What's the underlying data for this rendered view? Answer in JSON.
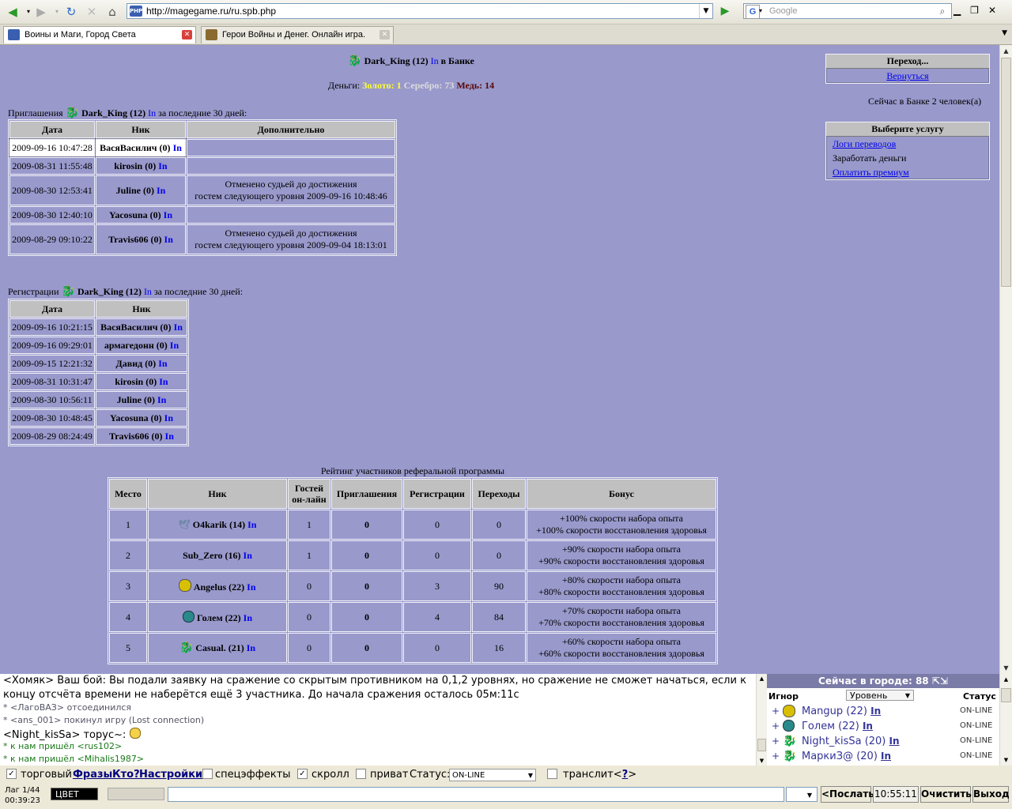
{
  "browser": {
    "url": "http://magegame.ru/ru.spb.php",
    "search_placeholder": "Google",
    "favicon_text": "PHP",
    "google_letter": "G",
    "tabs": [
      {
        "label": "Воины и Маги, Город Света",
        "active": true
      },
      {
        "label": "Герои Войны и Денег. Онлайн игра.",
        "active": false
      }
    ]
  },
  "bank": {
    "player": "Dark_King (12)",
    "info_link": "In",
    "location": "в Банке",
    "money_label": "Деньги:",
    "gold": "Золото: 1",
    "silver": "Серебро: 73",
    "copper": "Медь: 14",
    "people_in_bank": "Сейчас в Банке 2 человек(а)"
  },
  "nav_panel": {
    "title": "Переход...",
    "back": "Вернуться"
  },
  "services_panel": {
    "title": "Выберите услугу",
    "items": [
      {
        "label": "Логи переводов",
        "link": true
      },
      {
        "label": "Заработать деньги",
        "link": false
      },
      {
        "label": "Оплатить премиум",
        "link": true
      }
    ]
  },
  "invitations": {
    "prefix": "Приглашения",
    "player": "Dark_King (12)",
    "in": "In",
    "suffix": "за последние 30 дней:",
    "headers": [
      "Дата",
      "Ник",
      "Дополнительно"
    ],
    "rows": [
      {
        "date": "2009-09-16 10:47:28",
        "nick": "ВасяВасилич (0)",
        "extra1": "",
        "extra2": ""
      },
      {
        "date": "2009-08-31 11:55:48",
        "nick": "kirosin (0)",
        "extra1": "",
        "extra2": ""
      },
      {
        "date": "2009-08-30 12:53:41",
        "nick": "Juline (0)",
        "extra1": "Отменено судьей до достижения",
        "extra2": "гостем следующего уровня 2009-09-16 10:48:46"
      },
      {
        "date": "2009-08-30 12:40:10",
        "nick": "Yacosuna (0)",
        "extra1": "",
        "extra2": ""
      },
      {
        "date": "2009-08-29 09:10:22",
        "nick": "Travis606 (0)",
        "extra1": "Отменено судьей до достижения",
        "extra2": "гостем следующего уровня 2009-09-04 18:13:01"
      }
    ]
  },
  "registrations": {
    "prefix": "Регистрации",
    "player": "Dark_King (12)",
    "in": "In",
    "suffix": "за последние 30 дней:",
    "headers": [
      "Дата",
      "Ник"
    ],
    "rows": [
      {
        "date": "2009-09-16 10:21:15",
        "nick": "ВасяВасилич (0)"
      },
      {
        "date": "2009-09-16 09:29:01",
        "nick": "армагедонн (0)"
      },
      {
        "date": "2009-09-15 12:21:32",
        "nick": "Давид (0)"
      },
      {
        "date": "2009-08-31 10:31:47",
        "nick": "kirosin (0)"
      },
      {
        "date": "2009-08-30 10:56:11",
        "nick": "Juline (0)"
      },
      {
        "date": "2009-08-30 10:48:45",
        "nick": "Yacosuna (0)"
      },
      {
        "date": "2009-08-29 08:24:49",
        "nick": "Travis606 (0)"
      }
    ]
  },
  "rating": {
    "caption": "Рейтинг участников реферальной программы",
    "headers": [
      "Место",
      "Ник",
      "Гостей он-лайн",
      "Приглашения",
      "Регистрации",
      "Переходы",
      "Бонус"
    ],
    "rows": [
      {
        "place": "1",
        "icon": "guild-bird-icon",
        "nick": "O4karik (14)",
        "guests": "1",
        "invites": "0",
        "regs": "0",
        "clicks": "0",
        "bonus1": "+100% скорости набора опыта",
        "bonus2": "+100% скорости восстановления здоровья"
      },
      {
        "place": "2",
        "icon": "",
        "nick": "Sub_Zero (16)",
        "guests": "1",
        "invites": "0",
        "regs": "0",
        "clicks": "0",
        "bonus1": "+90% скорости набора опыта",
        "bonus2": "+90% скорости восстановления здоровья"
      },
      {
        "place": "3",
        "icon": "guild-yellow-icon",
        "nick": "Angelus (22)",
        "guests": "0",
        "invites": "0",
        "regs": "3",
        "clicks": "90",
        "bonus1": "+80% скорости набора опыта",
        "bonus2": "+80% скорости восстановления здоровья"
      },
      {
        "place": "4",
        "icon": "guild-teal-icon",
        "nick": "Голем (22)",
        "guests": "0",
        "invites": "0",
        "regs": "4",
        "clicks": "84",
        "bonus1": "+70% скорости набора опыта",
        "bonus2": "+70% скорости восстановления здоровья"
      },
      {
        "place": "5",
        "icon": "guild-dragon-icon",
        "nick": "Casual. (21)",
        "guests": "0",
        "invites": "0",
        "regs": "0",
        "clicks": "16",
        "bonus1": "+60% скорости набора опыта",
        "bonus2": "+60% скорости восстановления здоровья"
      }
    ],
    "in": "In"
  },
  "chat": {
    "lines": [
      {
        "text": "<Хомяк> Ваш бой: Вы подали заявку на сражение со скрытым противником на 0,1,2 уровнях, но сражение не сможет начаться, если к",
        "style": "big"
      },
      {
        "text": "концу отсчёта времени не наберётся ещё 3 участника. До начала сражения осталось 05м:11с",
        "style": "big"
      },
      {
        "text": "* <ЛагоВАЗ> отсоединился",
        "style": "sys"
      },
      {
        "text": "* <ans_001> покинул игру (Lost connection)",
        "style": "sys"
      },
      {
        "text": "<Night_kisSa> торус~: ",
        "style": "big"
      },
      {
        "text": "* к нам пришёл <rus102>",
        "style": "green"
      },
      {
        "text": "* к нам пришёл <Mihalis1987>",
        "style": "green"
      }
    ]
  },
  "online": {
    "title": "Сейчас в городе: 88",
    "col_ignore": "Игнор",
    "col_level": "Уровень",
    "col_status": "Статус",
    "users": [
      {
        "name": "Mangup (22)",
        "status": "ON-LINE",
        "icon_color": "#c8b000"
      },
      {
        "name": "Голем (22)",
        "status": "ON-LINE",
        "icon_color": "#2a8a8a"
      },
      {
        "name": "Night_kisSa (20)",
        "status": "ON-LINE",
        "icon_color": "#111111"
      },
      {
        "name": "МаркиЗ@ (20)",
        "status": "ON-LINE",
        "icon_color": "#8a1020"
      }
    ],
    "in": "In"
  },
  "controls": {
    "trade": "торговый",
    "phrases": "Фразы",
    "who": "Кто?",
    "settings": "Настройки",
    "effects": "спецэффекты",
    "scroll": "скролл",
    "private": "приват",
    "status_label": "Статус:",
    "status_value": "ON-LINE",
    "translit": "транслит",
    "translit_help": "?"
  },
  "bottom": {
    "lag": "Лаг 1/44",
    "timer": "00:39:23",
    "color_button": "ЦВЕТ",
    "send": "<Послать",
    "clock": "10:55:11",
    "clear": "Очистить",
    "exit": "Выход"
  }
}
